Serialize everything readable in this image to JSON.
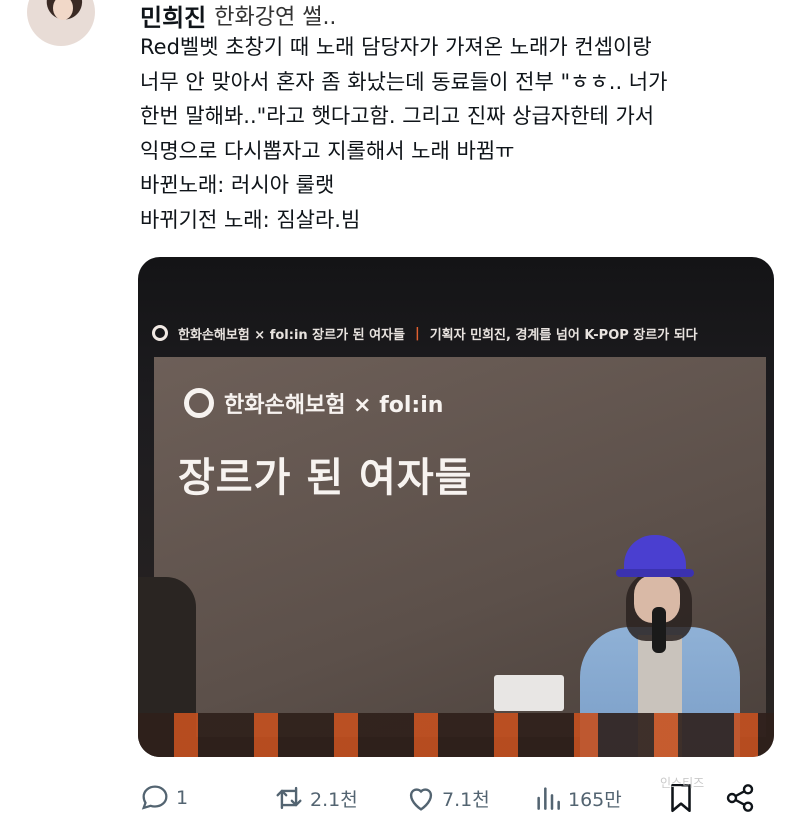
{
  "post": {
    "display_name": "민희진",
    "subtitle": "한화강연 썰..",
    "body_lines": [
      "Red벨벳 초창기 때 노래 담당자가 가져온 노래가 컨셉이랑",
      "너무 안 맞아서 혼자 좀 화났는데 동료들이 전부 \"ㅎㅎ.. 너가",
      "한번 말해봐..\"라고 햇다고함. 그리고 진짜 상급자한테 가서",
      "익명으로 다시뽑자고 지롤해서 노래 바뀜ㅠ",
      "바뀐노래: 러시아 룰랫",
      "바뀌기전 노래: 짐살라.빔"
    ]
  },
  "media": {
    "banner_brand": "한화손해보험 × fol:in 장르가 된 여자들",
    "banner_separator": "|",
    "banner_subtitle": "기획자 민희진, 경계를 넘어 K-POP 장르가 되다",
    "screen_brand": "한화손해보험 × fol:in",
    "screen_title": "장르가 된 여자들"
  },
  "actions": {
    "reply_count": "1",
    "retweet_count": "2.1천",
    "like_count": "7.1천",
    "view_count": "165만"
  },
  "watermark": "인스티즈",
  "colors": {
    "icon_gray": "#536471",
    "text": "#0f1419",
    "accent_orange": "#c5501f"
  }
}
